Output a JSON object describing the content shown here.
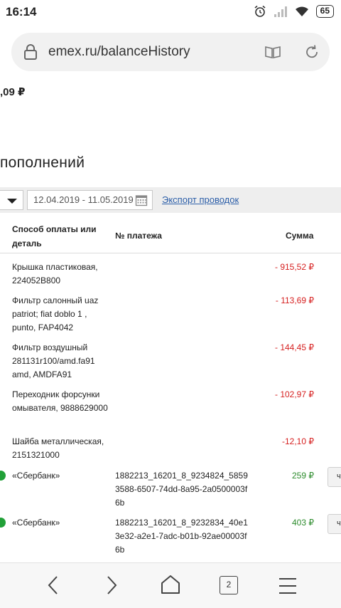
{
  "status": {
    "time": "16:14",
    "battery": "65"
  },
  "browser": {
    "url": "emex.ru/balanceHistory",
    "tabs_count": "2"
  },
  "page": {
    "balance_partial": ",09 ₽",
    "heading_partial": "пополнений",
    "filter": {
      "date_range": "12.04.2019 - 11.05.2019",
      "export_label": "Экспорт проводок"
    },
    "table": {
      "headers": {
        "method": "Способ оплаты или деталь",
        "payment": "№ платежа",
        "sum": "Сумма"
      },
      "rows": [
        {
          "detail": "Крышка пластиковая, 224052B800",
          "payment": "",
          "sum": "- 915,52 ₽",
          "type": "neg"
        },
        {
          "detail": "Фильтр салонный uaz patriot; fiat doblo 1 , punto, FAP4042",
          "payment": "",
          "sum": "- 113,69 ₽",
          "type": "neg"
        },
        {
          "detail": "Фильтр воздушный 281131r100/amd.fa91 amd, AMDFA91",
          "payment": "",
          "sum": "- 144,45 ₽",
          "type": "neg"
        },
        {
          "detail": "Переходник форсунки омывателя, 9888629000",
          "payment": "",
          "sum": "- 102,97 ₽",
          "type": "neg"
        },
        {
          "detail": "Шайба металлическая, 2151321000",
          "payment": "",
          "sum": "-12,10 ₽",
          "type": "neg"
        },
        {
          "detail": "«Сбербанк»",
          "payment": "1882213_16201_8_9234824_58593588-6507-74dd-8a95-2a0500003f6b",
          "sum": "259 ₽",
          "type": "pos",
          "action": "ч"
        },
        {
          "detail": "«Сбербанк»",
          "payment": "1882213_16201_8_9232834_40e13e32-a2e1-7adc-b01b-92ae00003f6b",
          "sum": "403 ₽",
          "type": "pos",
          "action": "ч"
        }
      ]
    }
  },
  "colors": {
    "negative": "#d62020",
    "positive": "#2c8b2c",
    "link": "#2a5da8",
    "sberbank": "#21a038"
  }
}
